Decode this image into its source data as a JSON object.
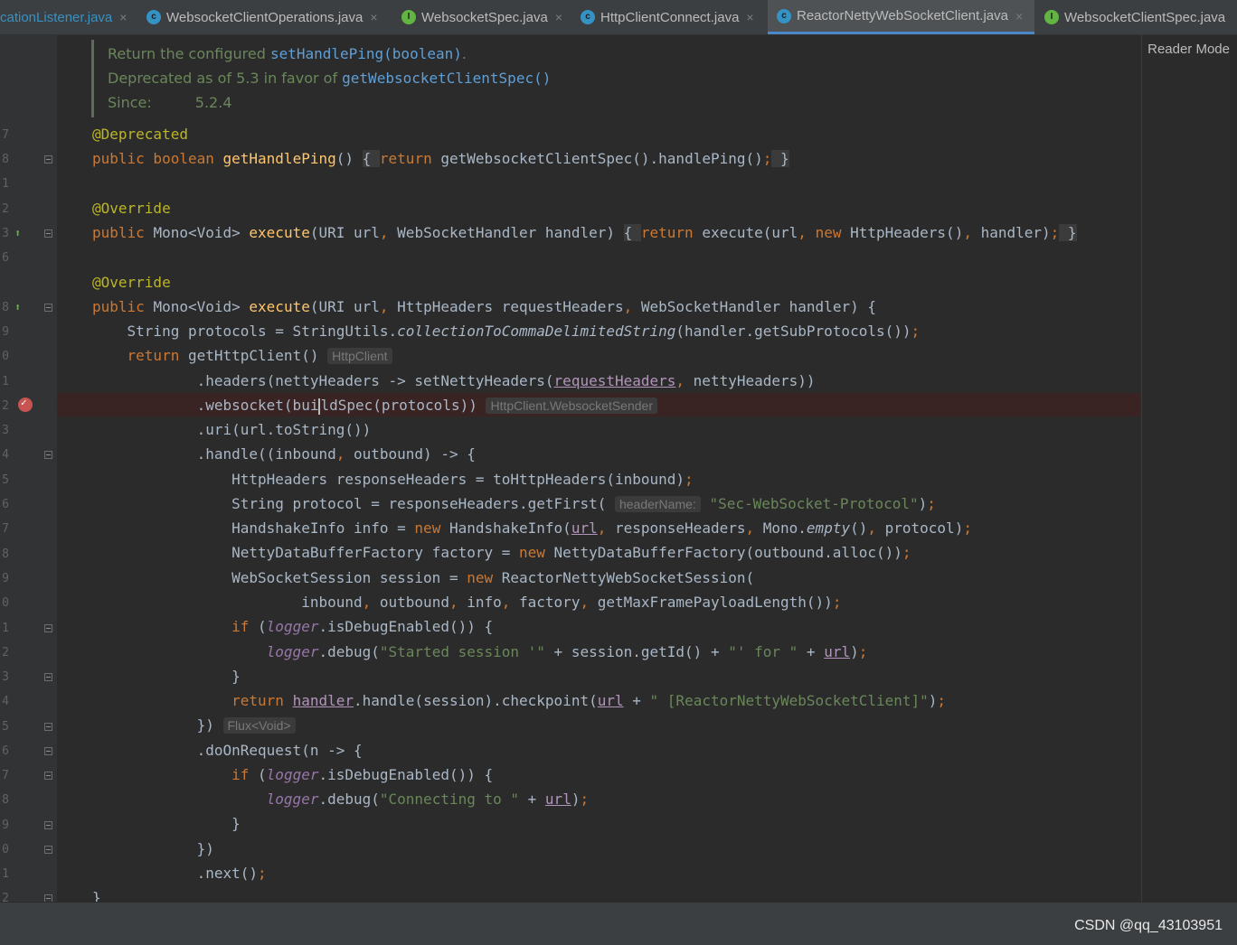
{
  "tabs": [
    {
      "label": "cationListener.java",
      "icon": "class-icon"
    },
    {
      "label": "WebsocketClientOperations.java",
      "icon": "class-icon"
    },
    {
      "label": "WebsocketSpec.java",
      "icon": "interface-icon"
    },
    {
      "label": "HttpClientConnect.java",
      "icon": "class-icon"
    },
    {
      "label": "ReactorNettyWebSocketClient.java",
      "icon": "class-icon",
      "active": true
    },
    {
      "label": "WebsocketClientSpec.java",
      "icon": "interface-icon"
    }
  ],
  "close_glyph": "×",
  "reader_mode": "Reader Mode",
  "doc": {
    "line1_prefix": "Return the configured ",
    "line1_link": "setHandlePing(boolean)",
    "line1_suffix": ".",
    "line2_prefix": "Deprecated as of 5.3 in favor of ",
    "line2_link": "getWebsocketClientSpec()",
    "line3_label": "Since:",
    "line3_value": "5.2.4"
  },
  "line_numbers": [
    "7",
    "8",
    "1",
    "2",
    "3",
    "6",
    "8",
    "9",
    "0",
    "1",
    "2",
    "3",
    "4",
    "5",
    "6",
    "7",
    "8",
    "9",
    "0",
    "1",
    "2",
    "3",
    "4",
    "5",
    "6",
    "7",
    "8",
    "9",
    "0",
    "1",
    "2"
  ],
  "hints": {
    "http_client": "HttpClient",
    "websocket_sender": "HttpClient.WebsocketSender",
    "header_name": "headerName:",
    "flux_void": "Flux<Void>"
  },
  "watermark": "CSDN @qq_43103951"
}
